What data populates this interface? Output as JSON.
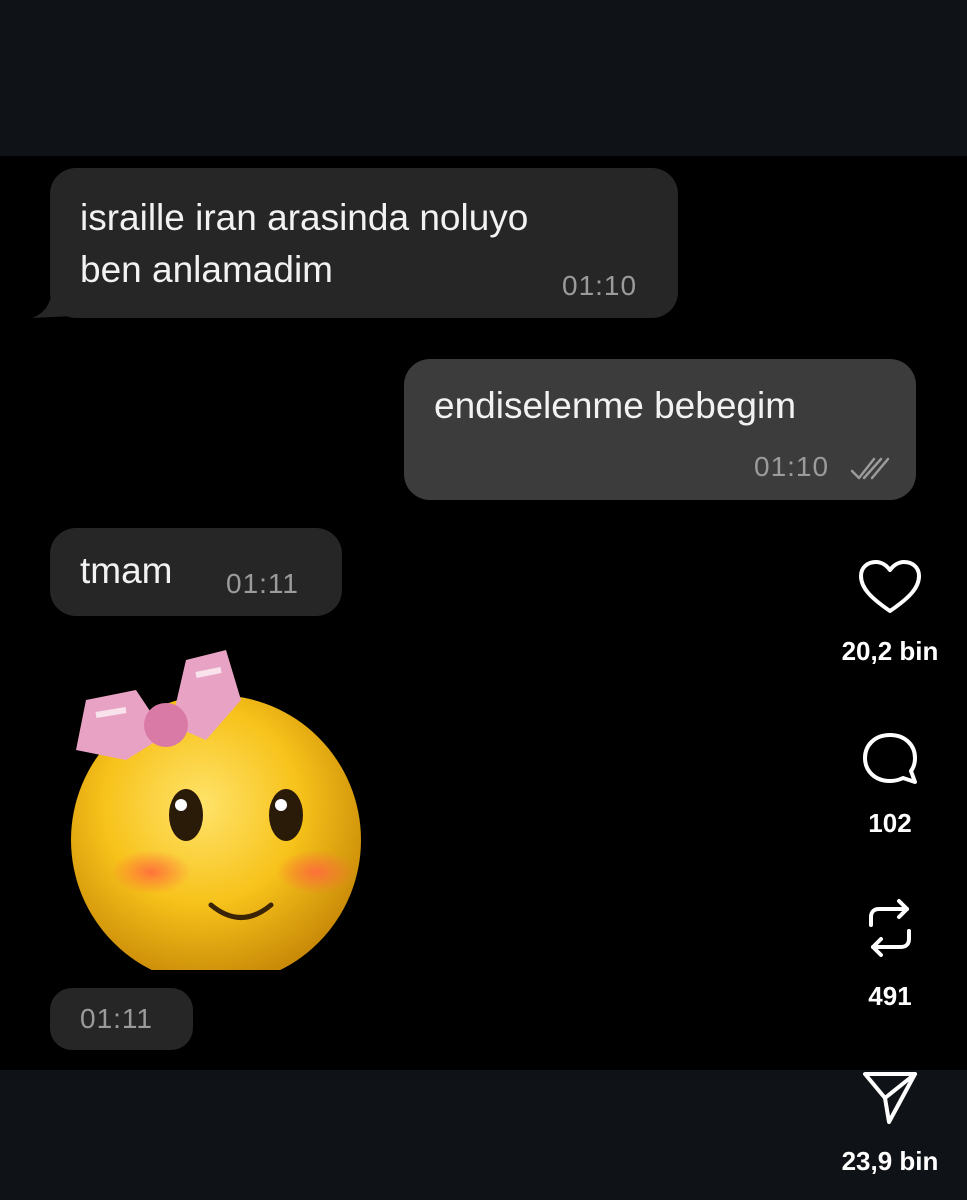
{
  "messages": [
    {
      "direction": "incoming",
      "text": "israille iran arasinda noluyo\nben anlamadim",
      "time": "01:10"
    },
    {
      "direction": "outgoing",
      "text": "endiselenme bebegim",
      "time": "01:10",
      "status_icon": "double-check-icon"
    },
    {
      "direction": "incoming",
      "text": "tmam",
      "time": "01:11"
    }
  ],
  "sticker": {
    "icon": "blushing-smiley-with-pink-bow-sticker",
    "time": "01:11"
  },
  "actions": {
    "like": {
      "icon": "heart-icon",
      "count": "20,2 bin"
    },
    "comment": {
      "icon": "comment-bubble-icon",
      "count": "102"
    },
    "repost": {
      "icon": "repost-icon",
      "count": "491"
    },
    "share": {
      "icon": "send-icon",
      "count": "23,9 bin"
    }
  },
  "colors": {
    "background": "#000000",
    "band": "#0f1216",
    "incoming_bubble": "#262626",
    "outgoing_bubble": "#3c3c3c",
    "timestamp": "#9b9b9b",
    "sticker_face": "#f7c21a",
    "sticker_bow": "#e8a3c4"
  }
}
